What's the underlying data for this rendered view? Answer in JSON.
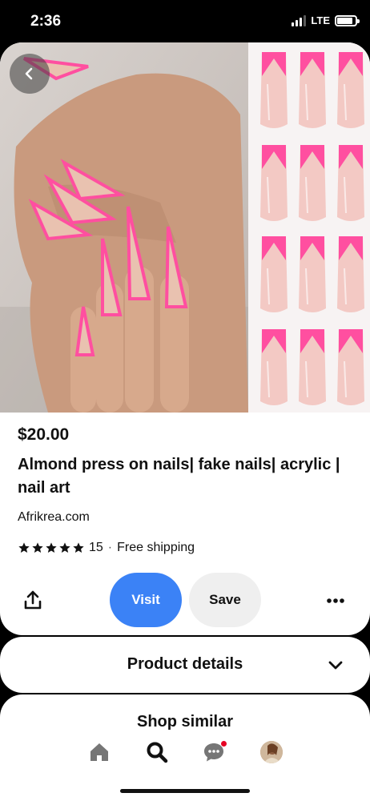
{
  "status_bar": {
    "time": "2:36",
    "network": "LTE",
    "signal_bars": 3,
    "battery_level": 0.85
  },
  "pin": {
    "back_icon": "chevron-left-icon",
    "price": "$20.00",
    "title": "Almond press on nails| fake nails| acrylic | nail art",
    "source": "Afrikrea.com",
    "rating": 5,
    "review_count": "15",
    "separator": "·",
    "shipping": "Free shipping"
  },
  "actions": {
    "share_icon": "share-icon",
    "visit_label": "Visit",
    "save_label": "Save",
    "more_icon": "more-dots-icon"
  },
  "sections": {
    "product_details_label": "Product details",
    "shop_similar_label": "Shop similar"
  },
  "bottom_nav": {
    "items": [
      {
        "icon": "home-icon"
      },
      {
        "icon": "search-icon"
      },
      {
        "icon": "messages-icon",
        "has_notification": true
      },
      {
        "icon": "profile-avatar"
      }
    ]
  },
  "colors": {
    "visit_button": "#3b82f6",
    "save_button": "#efefef",
    "notification": "#e60023",
    "nail_pink": "#ff4fa0",
    "nail_nude": "#f3c9c4"
  }
}
